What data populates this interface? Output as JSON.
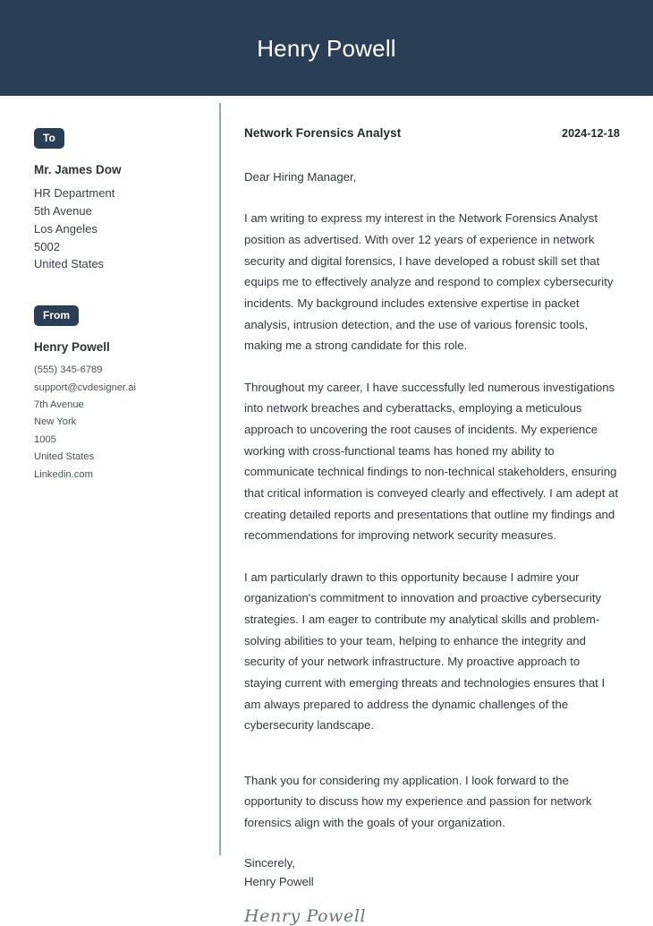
{
  "header": {
    "name": "Henry Powell"
  },
  "colors": {
    "header_background": "#2a3f55",
    "badge_background": "#2a3f55",
    "badge_text": "#ffffff",
    "body_text": "#33383d",
    "divider": "#9aa7b4",
    "signature_text": "#6d7479",
    "page_background": "#ffffff"
  },
  "sidebar": {
    "to": {
      "badge_label": "To",
      "recipient_name": "Mr. James Dow",
      "lines": [
        "HR Department",
        "5th Avenue",
        "Los Angeles",
        "5002",
        "United States"
      ]
    },
    "from": {
      "badge_label": "From",
      "sender_name": "Henry Powell",
      "lines": [
        "(555) 345-6789",
        "support@cvdesigner.ai",
        "7th Avenue",
        "New York",
        "1005",
        "United States",
        "Linkedin.com"
      ]
    }
  },
  "letter": {
    "job_title": "Network Forensics Analyst",
    "date": "2024-12-18",
    "salutation": "Dear Hiring Manager,",
    "paragraphs": [
      "I am writing to express my interest in the Network Forensics Analyst position as advertised. With over 12 years of experience in network security and digital forensics, I have developed a robust skill set that equips me to effectively analyze and respond to complex cybersecurity incidents. My background includes extensive expertise in packet analysis, intrusion detection, and the use of various forensic tools, making me a strong candidate for this role.",
      "Throughout my career, I have successfully led numerous investigations into network breaches and cyberattacks, employing a meticulous approach to uncovering the root causes of incidents. My experience working with cross-functional teams has honed my ability to communicate technical findings to non-technical stakeholders, ensuring that critical information is conveyed clearly and effectively. I am adept at creating detailed reports and presentations that outline my findings and recommendations for improving network security measures.",
      "I am particularly drawn to this opportunity because I admire your organization's commitment to innovation and proactive cybersecurity strategies. I am eager to contribute my analytical skills and problem-solving abilities to your team, helping to enhance the integrity and security of your network infrastructure. My proactive approach to staying current with emerging threats and technologies ensures that I am always prepared to address the dynamic challenges of the cybersecurity landscape.",
      "Thank you for considering my application. I look forward to the opportunity to discuss how my experience and passion for network forensics align with the goals of your organization."
    ],
    "closing": "Sincerely,",
    "closing_name": "Henry Powell",
    "signature": "Henry Powell"
  }
}
